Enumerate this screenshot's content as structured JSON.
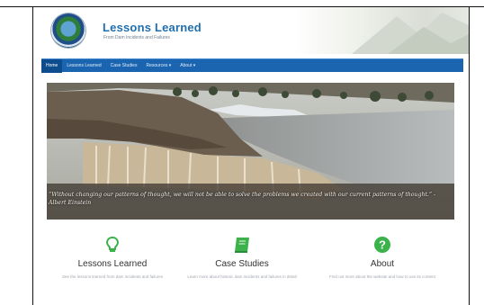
{
  "site": {
    "title": "Lessons Learned",
    "subtitle": "From Dam Incidents and Failures"
  },
  "nav": {
    "items": [
      "Home",
      "Lessons Learned",
      "Case Studies",
      "Resources ▾",
      "About ▾"
    ],
    "active_index": 0
  },
  "hero": {
    "quote": "“Without changing our patterns of thought, we will not be able to solve the problems we created with our current patterns of thought.” - Albert Einstein"
  },
  "features": [
    {
      "title": "Lessons Learned",
      "icon": "lightbulb-icon",
      "color": "#3bb34a",
      "text": "See the lessons learned from dam incidents and failures"
    },
    {
      "title": "Case Studies",
      "icon": "book-icon",
      "color": "#3bb34a",
      "text": "Learn more about historic dam incidents and failures in detail"
    },
    {
      "title": "About",
      "icon": "question-circle-icon",
      "color": "#3bb34a",
      "text": "Find out more about the website and how to use its content"
    }
  ],
  "colors": {
    "brand_blue": "#1f6fb0",
    "nav_blue": "#1a64b0",
    "accent_green": "#3bb34a"
  }
}
